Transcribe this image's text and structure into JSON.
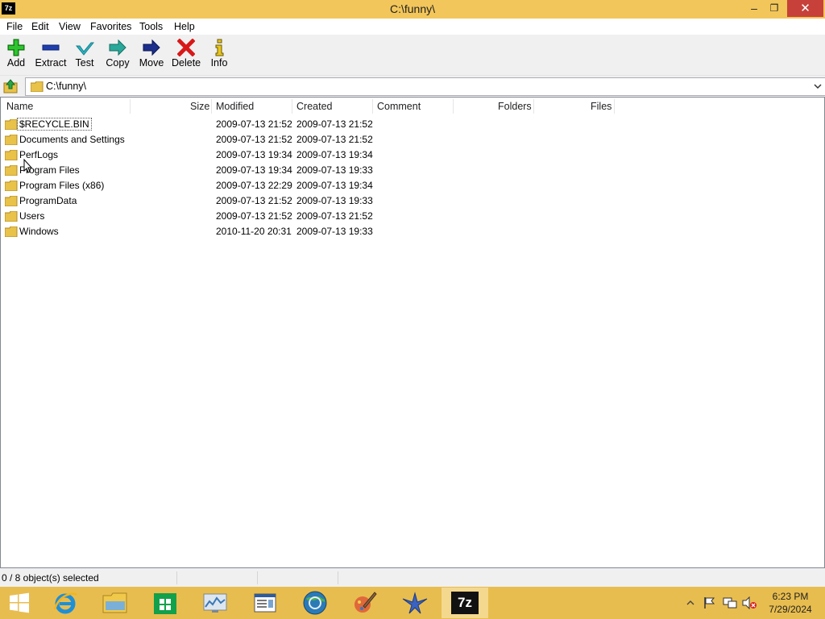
{
  "window": {
    "title": "C:\\funny\\",
    "app_icon_text": "7z",
    "minimize_glyph": "–",
    "maximize_glyph": "❐",
    "close_glyph": "✕"
  },
  "menu": [
    "File",
    "Edit",
    "View",
    "Favorites",
    "Tools",
    "Help"
  ],
  "toolbar": {
    "add": "Add",
    "extract": "Extract",
    "test": "Test",
    "copy": "Copy",
    "move": "Move",
    "delete": "Delete",
    "info": "Info"
  },
  "address": {
    "path": "C:\\funny\\"
  },
  "columns": {
    "name": "Name",
    "size": "Size",
    "modified": "Modified",
    "created": "Created",
    "comment": "Comment",
    "folders": "Folders",
    "files": "Files"
  },
  "rows": [
    {
      "name": "$RECYCLE.BIN",
      "modified": "2009-07-13 21:52",
      "created": "2009-07-13 21:52"
    },
    {
      "name": "Documents and Settings",
      "modified": "2009-07-13 21:52",
      "created": "2009-07-13 21:52"
    },
    {
      "name": "PerfLogs",
      "modified": "2009-07-13 19:34",
      "created": "2009-07-13 19:34"
    },
    {
      "name": "Program Files",
      "modified": "2009-07-13 19:34",
      "created": "2009-07-13 19:33"
    },
    {
      "name": "Program Files (x86)",
      "modified": "2009-07-13 22:29",
      "created": "2009-07-13 19:34"
    },
    {
      "name": "ProgramData",
      "modified": "2009-07-13 21:52",
      "created": "2009-07-13 19:33"
    },
    {
      "name": "Users",
      "modified": "2009-07-13 21:52",
      "created": "2009-07-13 21:52"
    },
    {
      "name": "Windows",
      "modified": "2010-11-20 20:31",
      "created": "2009-07-13 19:33"
    }
  ],
  "status": {
    "selection": "0 / 8 object(s) selected"
  },
  "taskbar": {
    "time": "6:23 PM",
    "date": "7/29/2024",
    "active_app_label": "7z"
  },
  "colors": {
    "titlebar": "#f2c65a",
    "taskbar": "#e8bd4f",
    "close": "#c7403a"
  }
}
